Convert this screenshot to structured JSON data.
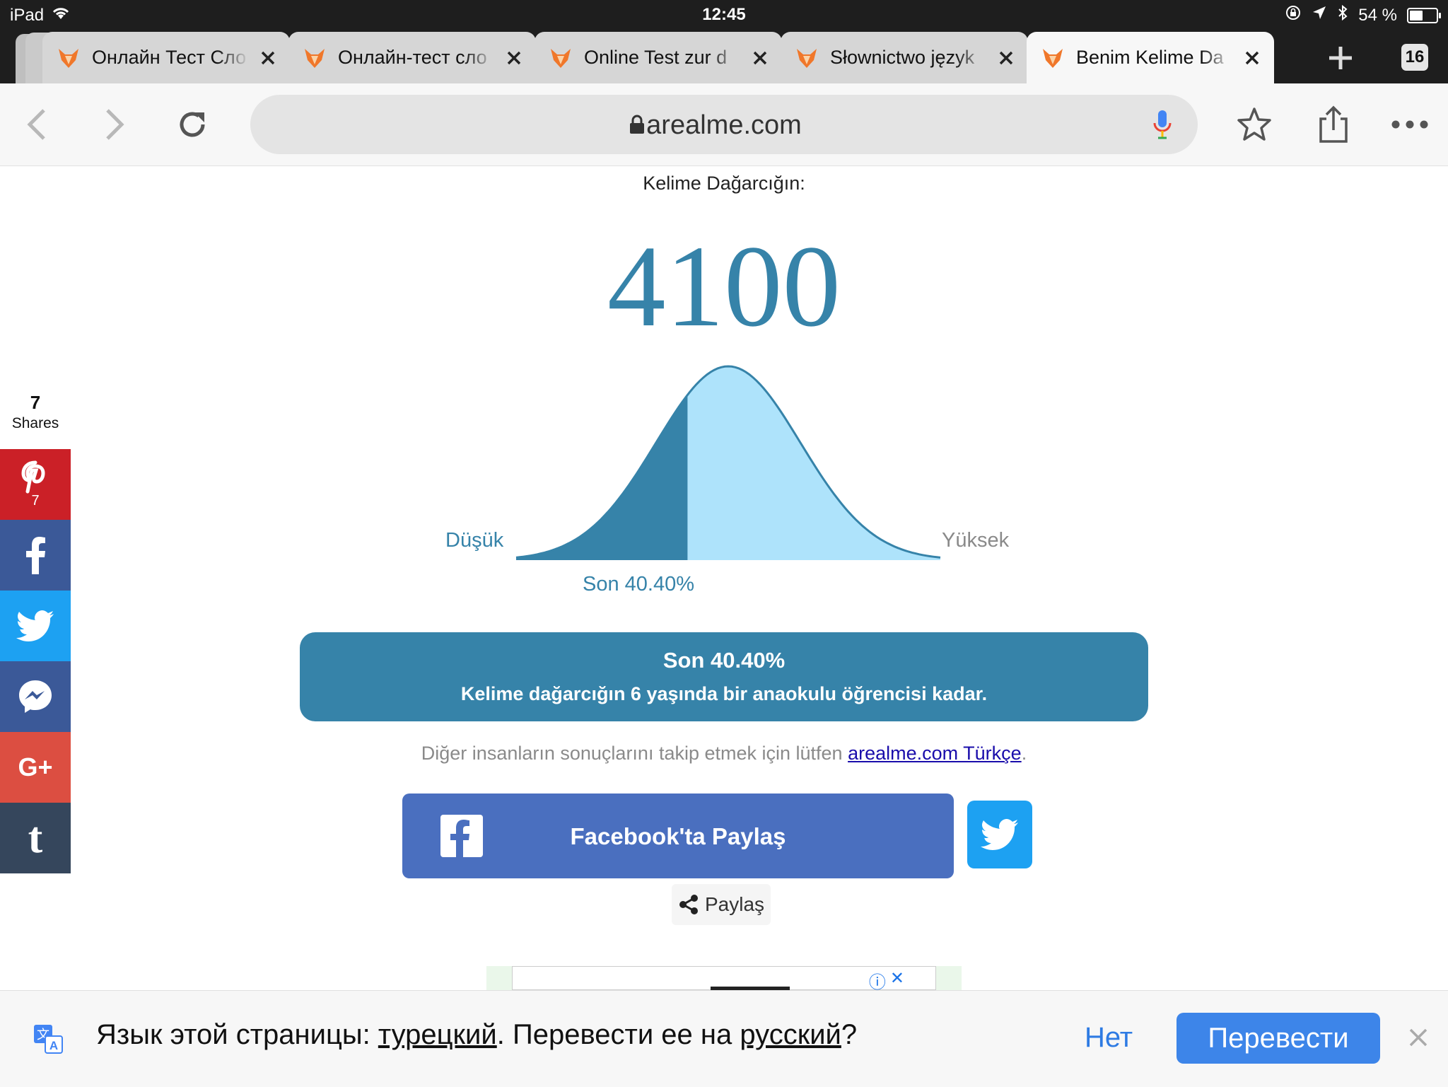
{
  "status_bar": {
    "device": "iPad",
    "time": "12:45",
    "battery_text": "54 %",
    "battery_level": 0.54
  },
  "tabs": [
    {
      "title": "Онлайн Тест Сло",
      "active": false
    },
    {
      "title": "Онлайн-тест сло",
      "active": false
    },
    {
      "title": "Online Test zur d",
      "active": false
    },
    {
      "title": "Słownictwo język",
      "active": false
    },
    {
      "title": "Benim Kelime Da",
      "active": true
    }
  ],
  "tab_count": "16",
  "toolbar": {
    "url": "arealme.com"
  },
  "result": {
    "heading": "Kelime Dağarcığın:",
    "score": "4100",
    "low_label": "Düşük",
    "high_label": "Yüksek",
    "percentile_label": "Son 40.40%",
    "percentile": 0.404,
    "box_title": "Son 40.40%",
    "box_description": "Kelime dağarcığın 6 yaşında bir anaokulu öğrencisi kadar."
  },
  "follow": {
    "prefix": "Diğer insanların sonuçlarını takip etmek için lütfen",
    "link": "arealme.com Türkçe",
    "suffix": "."
  },
  "share": {
    "facebook_label": "Facebook'ta Paylaş",
    "generic_label": "Paylaş"
  },
  "sidebar": {
    "count": "7",
    "count_label": "Shares",
    "pinterest_count": "7",
    "colors": {
      "pinterest": "#cb2027",
      "facebook": "#3b5998",
      "twitter": "#1da1f2",
      "messenger": "#3b5998",
      "googleplus": "#dc4e41",
      "tumblr": "#35465c"
    }
  },
  "translate": {
    "prefix": "Язык этой страницы: ",
    "lang_from": "турецкий",
    "middle": ". Перевести ее на ",
    "lang_to": "русский",
    "suffix": "?",
    "no_label": "Нет",
    "yes_label": "Перевести"
  },
  "colors": {
    "accent": "#3683a9",
    "curve_light": "#aee3fb"
  }
}
